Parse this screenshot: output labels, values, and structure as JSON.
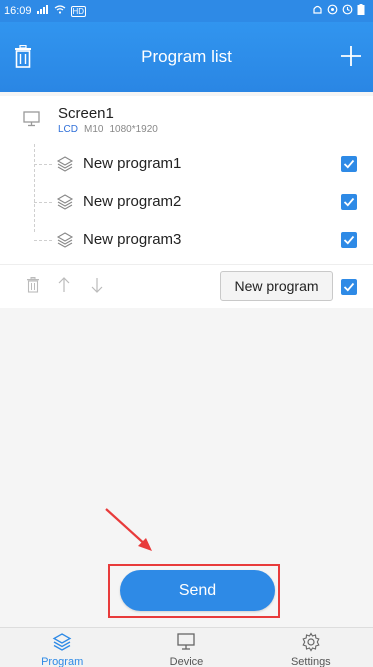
{
  "status_bar": {
    "time": "16:09",
    "signal": "⠴ ıl",
    "wifi": "≋",
    "hd": "HD",
    "right_icons": "⏰ ◎ ◷ ▮"
  },
  "header": {
    "title": "Program list",
    "left_icon": "trash-icon",
    "right_icon": "plus-icon"
  },
  "screen": {
    "name": "Screen1",
    "type": "LCD",
    "model": "M10",
    "resolution": "1080*1920",
    "icon": "monitor-icon"
  },
  "programs": [
    {
      "name": "New program1",
      "checked": true
    },
    {
      "name": "New program2",
      "checked": true
    },
    {
      "name": "New program3",
      "checked": true
    }
  ],
  "actions": {
    "new_program_label": "New program",
    "select_all_checked": true
  },
  "send_label": "Send",
  "bottom_nav": [
    {
      "label": "Program",
      "icon": "layers-icon",
      "active": true
    },
    {
      "label": "Device",
      "icon": "monitor-icon",
      "active": false
    },
    {
      "label": "Settings",
      "icon": "gear-icon",
      "active": false
    }
  ],
  "colors": {
    "accent": "#2e8ae6",
    "annotation": "#e83b3b"
  }
}
